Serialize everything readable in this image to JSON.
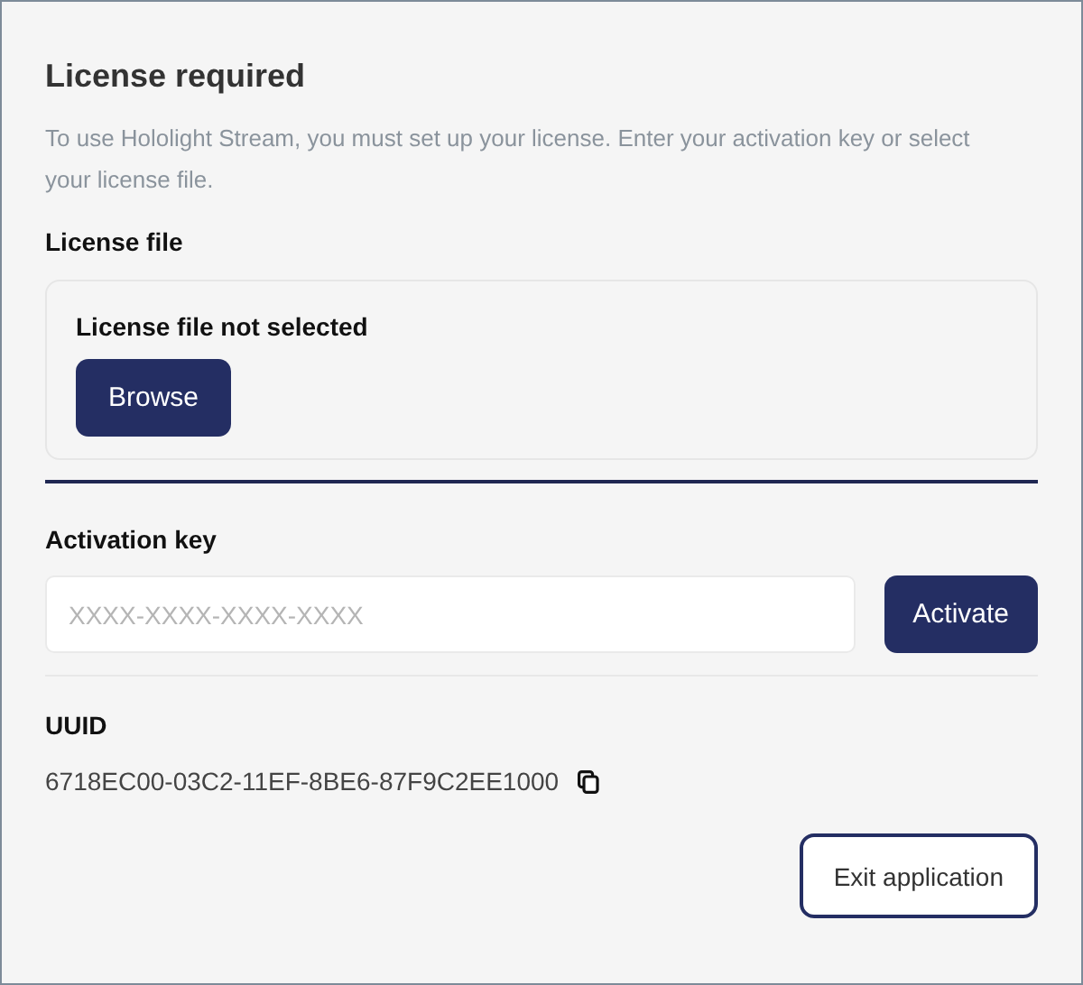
{
  "title": "License required",
  "description": "To use Hololight Stream, you must set up your license. Enter your activation key or select your license file.",
  "license_file": {
    "label": "License file",
    "status": "License file not selected",
    "button": "Browse"
  },
  "activation": {
    "label": "Activation key",
    "placeholder": "XXXX-XXXX-XXXX-XXXX",
    "button": "Activate"
  },
  "uuid": {
    "label": "UUID",
    "value": "6718EC00-03C2-11EF-8BE6-87F9C2EE1000"
  },
  "exit_button": "Exit application"
}
